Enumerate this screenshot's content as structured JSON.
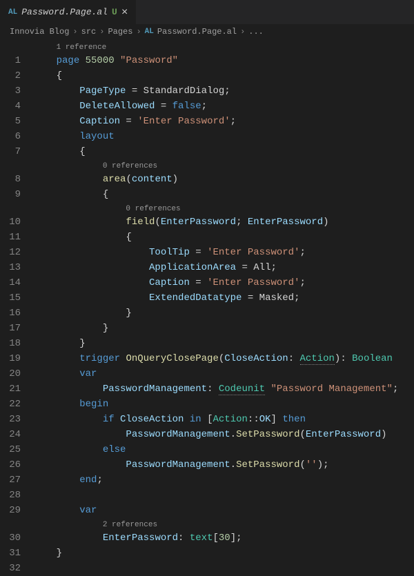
{
  "tab": {
    "lang": "AL",
    "name": "Password.Page.al",
    "modified": "U",
    "close": "×"
  },
  "breadcrumb": {
    "parts": [
      "Innovia Blog",
      "src",
      "Pages"
    ],
    "lang": "AL",
    "file": "Password.Page.al",
    "sep": "›",
    "more": "..."
  },
  "codelens": {
    "ref1": "1 reference",
    "ref0a": "0 references",
    "ref0b": "0 references",
    "ref2": "2 references"
  },
  "code": {
    "l1": {
      "kw": "page",
      "num": "55000",
      "str": "\"Password\""
    },
    "l2": "{",
    "l3": {
      "p": "PageType",
      "v": "StandardDialog"
    },
    "l4": {
      "p": "DeleteAllowed",
      "v": "false"
    },
    "l5": {
      "p": "Caption",
      "v": "'Enter Password'"
    },
    "l6": "layout",
    "l7": "{",
    "l8": {
      "fn": "area",
      "arg": "content"
    },
    "l9": "{",
    "l10": {
      "fn": "field",
      "a1": "EnterPassword",
      "a2": "EnterPassword"
    },
    "l11": "{",
    "l12": {
      "p": "ToolTip",
      "v": "'Enter Password'"
    },
    "l13": {
      "p": "ApplicationArea",
      "v": "All"
    },
    "l14": {
      "p": "Caption",
      "v": "'Enter Password'"
    },
    "l15": {
      "p": "ExtendedDatatype",
      "v": "Masked"
    },
    "l16": "}",
    "l17": "}",
    "l18": "}",
    "l19": {
      "kw": "trigger",
      "fn": "OnQueryClosePage",
      "p": "CloseAction",
      "pt": "Action",
      "rt": "Boolean"
    },
    "l20": "var",
    "l21": {
      "v": "PasswordManagement",
      "t": "Codeunit",
      "s": "\"Password Management\""
    },
    "l22": "begin",
    "l23": {
      "kw1": "if",
      "v": "CloseAction",
      "kw2": "in",
      "t": "Action",
      "m": "OK",
      "kw3": "then"
    },
    "l24": {
      "o": "PasswordManagement",
      "m": "SetPassword",
      "a": "EnterPassword"
    },
    "l25": "else",
    "l26": {
      "o": "PasswordManagement",
      "m": "SetPassword",
      "a": "''"
    },
    "l27": "end",
    "l29": "var",
    "l30": {
      "v": "EnterPassword",
      "t": "text",
      "n": "30"
    },
    "l31": "}"
  },
  "indent": {
    "i1": "    ",
    "i2": "        ",
    "i3": "            ",
    "i4": "                ",
    "i5": "                    "
  }
}
